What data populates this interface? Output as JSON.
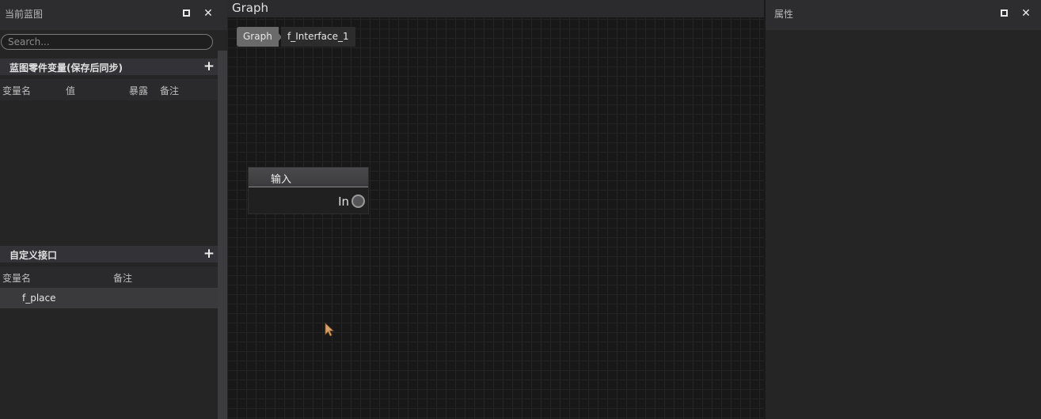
{
  "left_panel": {
    "title": "当前蓝图",
    "search": {
      "placeholder": "Search...",
      "value": ""
    },
    "variables_section": {
      "title": "蓝图零件变量(保存后同步)",
      "add_label": "+",
      "columns": [
        "变量名",
        "值",
        "暴露",
        "备注"
      ],
      "rows": []
    },
    "interfaces_section": {
      "title": "自定义接口",
      "add_label": "+",
      "columns": [
        "变量名",
        "备注"
      ],
      "rows": [
        {
          "name": "f_place"
        }
      ]
    }
  },
  "graph": {
    "title": "Graph",
    "breadcrumbs": [
      "Graph",
      "f_Interface_1"
    ],
    "node": {
      "title": "输入",
      "pin_label": "In"
    }
  },
  "right_panel": {
    "title": "属性"
  },
  "colors": {
    "panel_bg": "#252526",
    "header_bg": "#2d2d30",
    "graph_bg": "#181818",
    "cursor": "#d9a06a"
  },
  "icons": [
    "restore-icon",
    "close-icon",
    "plus-icon",
    "mouse-cursor-icon"
  ]
}
